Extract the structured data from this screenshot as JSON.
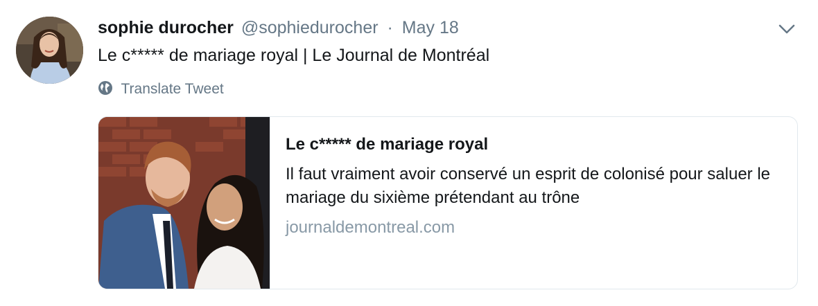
{
  "tweet": {
    "author": {
      "display_name": "sophie durocher",
      "handle": "@sophiedurocher"
    },
    "separator": "·",
    "date": "May 18",
    "text": "Le c***** de mariage royal | Le Journal de Montréal",
    "translate_label": "Translate Tweet",
    "card": {
      "title": "Le c***** de mariage royal",
      "description": "Il faut vraiment avoir conservé un esprit de colonisé pour saluer le mariage du sixième prétendant au trône",
      "domain": "journaldemontreal.com"
    }
  },
  "colors": {
    "primary_text": "#14171a",
    "secondary_text": "#657786",
    "domain_text": "#8899a6",
    "border": "#e1e8ed"
  },
  "icons": {
    "translate": "globe-icon",
    "menu": "chevron-down-icon"
  }
}
